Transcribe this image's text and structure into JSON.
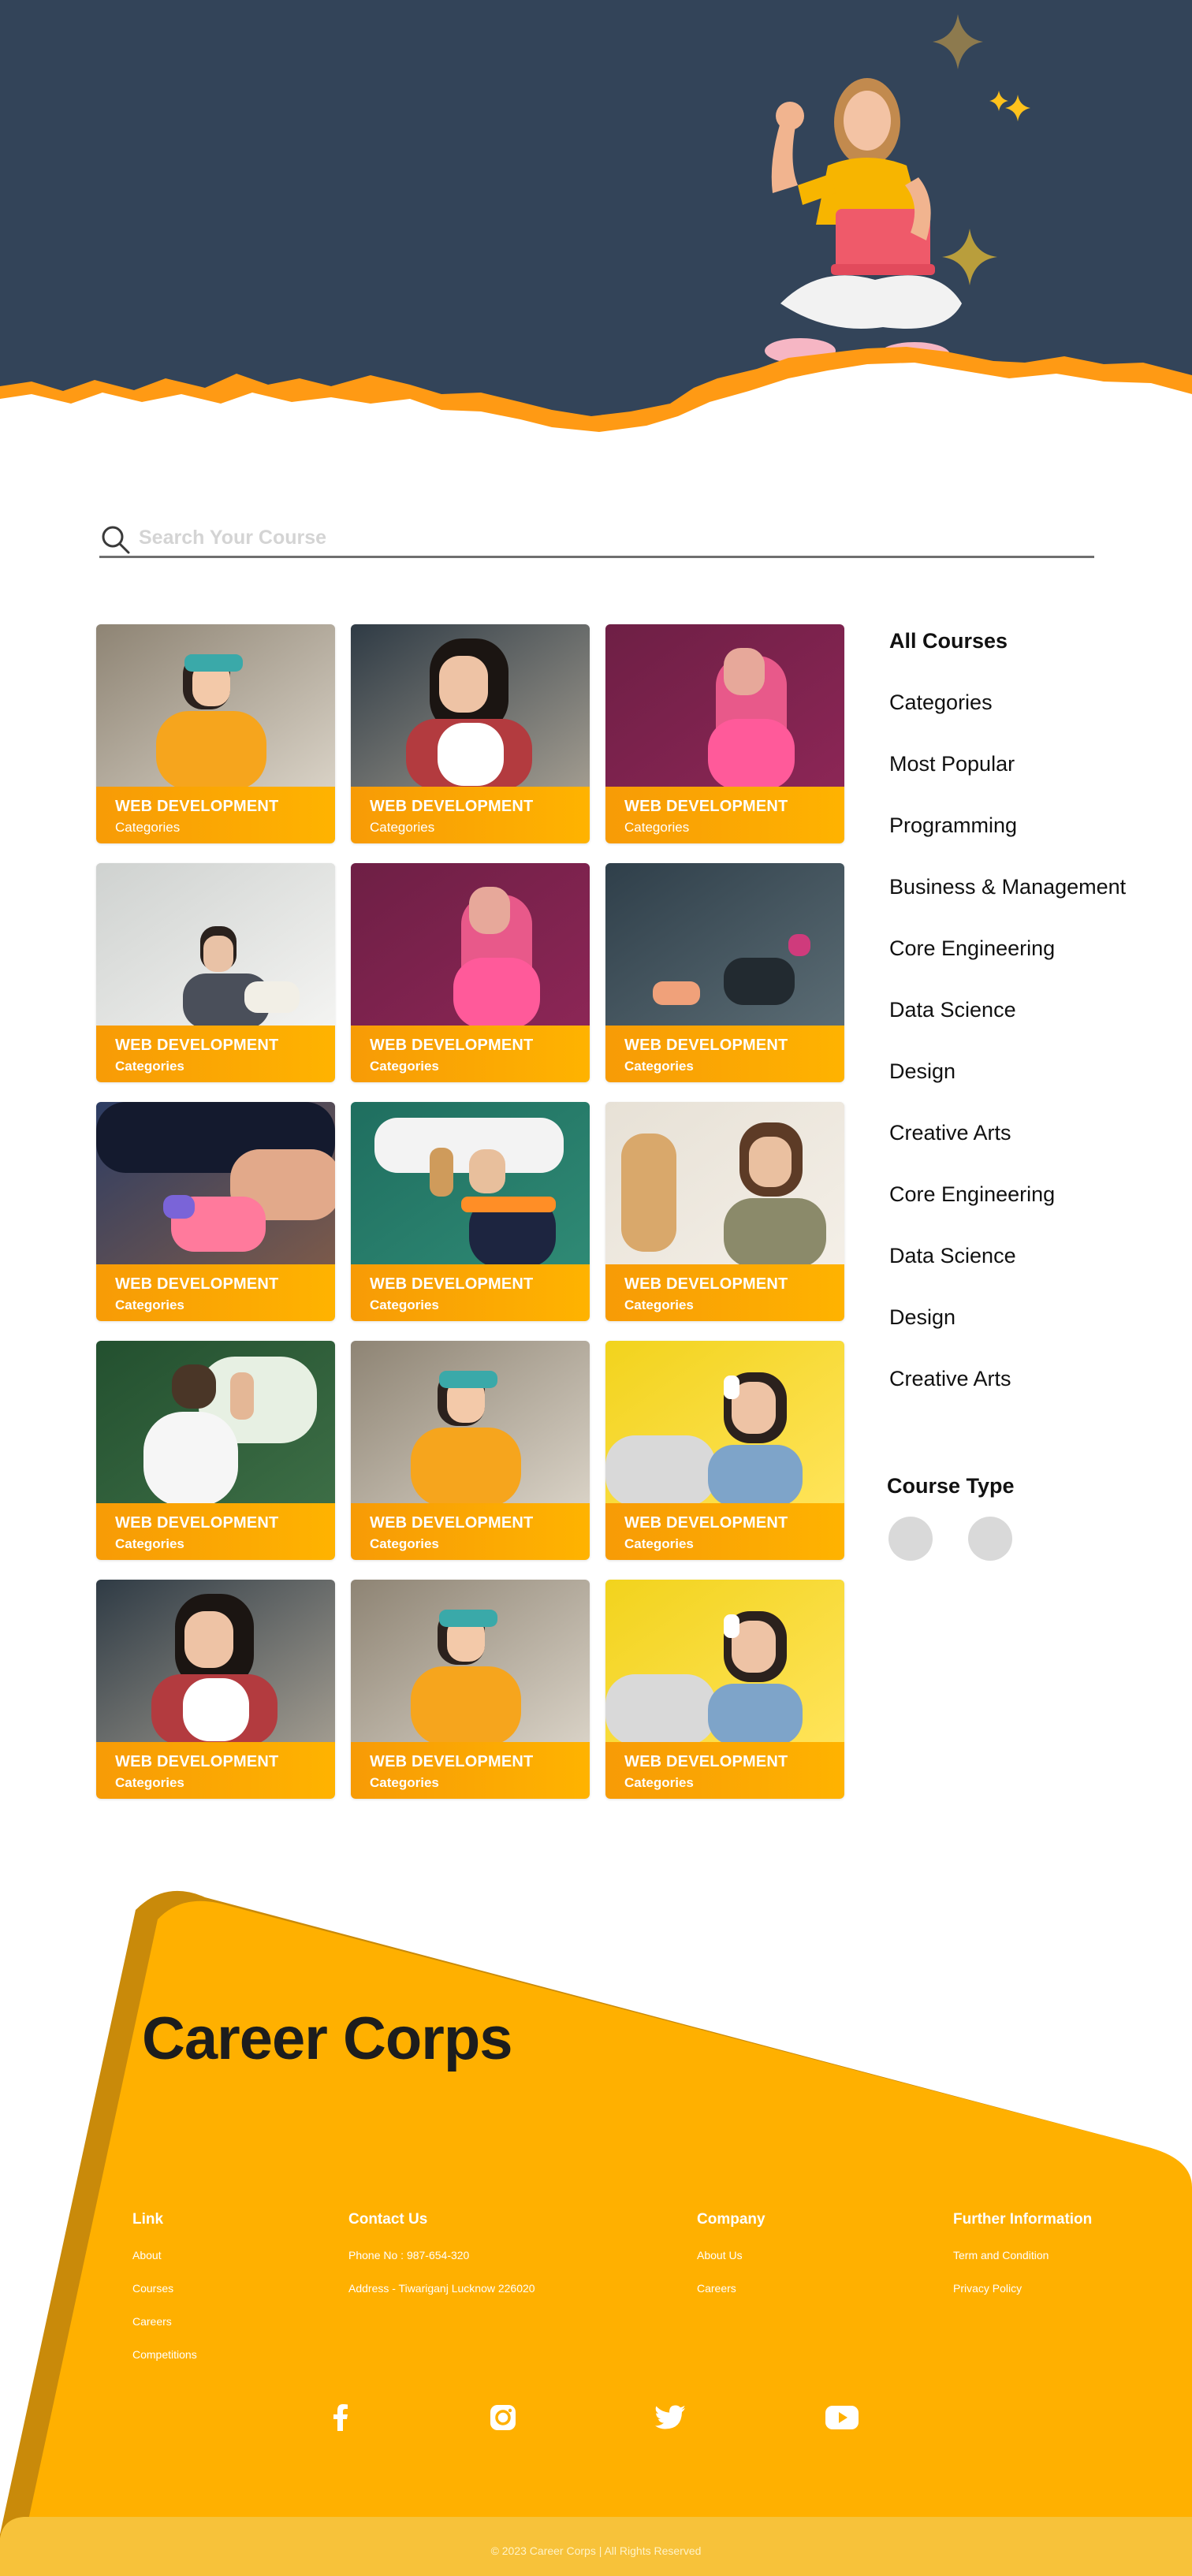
{
  "search": {
    "placeholder": "Search Your Course"
  },
  "cards": [
    {
      "title": "WEB DEVELOPMENT",
      "subtitle": "Categories",
      "photo": "woman-headphones-yellow-shirt"
    },
    {
      "title": "WEB DEVELOPMENT",
      "subtitle": "Categories",
      "photo": "woman-glasses-plaid-shirt"
    },
    {
      "title": "WEB DEVELOPMENT",
      "subtitle": "Categories",
      "photo": "woman-pink-hair-magenta"
    },
    {
      "title": "WEB DEVELOPMENT",
      "subtitle": "Categories",
      "photo": "man-headphones-reading-book"
    },
    {
      "title": "WEB DEVELOPMENT",
      "subtitle": "Categories",
      "photo": "woman-pink-hair-magenta"
    },
    {
      "title": "WEB DEVELOPMENT",
      "subtitle": "Categories",
      "photo": "dancers-dark-wall"
    },
    {
      "title": "WEB DEVELOPMENT",
      "subtitle": "Categories",
      "photo": "drawing-tablet-stylus"
    },
    {
      "title": "WEB DEVELOPMENT",
      "subtitle": "Categories",
      "photo": "man-hourglass-chalkboard"
    },
    {
      "title": "WEB DEVELOPMENT",
      "subtitle": "Categories",
      "photo": "man-curly-hair-painter"
    },
    {
      "title": "WEB DEVELOPMENT",
      "subtitle": "Categories",
      "photo": "boy-writing-chalkboard"
    },
    {
      "title": "WEB DEVELOPMENT",
      "subtitle": "Categories",
      "photo": "woman-headphones-yellow-shirt"
    },
    {
      "title": "WEB DEVELOPMENT",
      "subtitle": "Categories",
      "photo": "woman-headphones-laptop-yellow"
    },
    {
      "title": "WEB DEVELOPMENT",
      "subtitle": "Categories",
      "photo": "woman-glasses-plaid-shirt"
    },
    {
      "title": "WEB DEVELOPMENT",
      "subtitle": "Categories",
      "photo": "woman-headphones-yellow-shirt"
    },
    {
      "title": "WEB DEVELOPMENT",
      "subtitle": "Categories",
      "photo": "woman-headphones-laptop-yellow"
    }
  ],
  "sidebar": {
    "items": [
      {
        "label": "All  Courses",
        "active": true
      },
      {
        "label": "Categories"
      },
      {
        "label": "Most Popular"
      },
      {
        "label": "Programming"
      },
      {
        "label": "Business & Management"
      },
      {
        "label": "Core Engineering"
      },
      {
        "label": "Data Science"
      },
      {
        "label": "Design"
      },
      {
        "label": "Creative Arts"
      },
      {
        "label": "Core Engineering"
      },
      {
        "label": "Data Science"
      },
      {
        "label": "Design"
      },
      {
        "label": "Creative Arts"
      }
    ],
    "course_type_label": "Course Type"
  },
  "footer": {
    "brand": "Career Corps",
    "columns": [
      {
        "heading": "Link",
        "links": [
          "About",
          "Courses",
          "Careers",
          "Competitions"
        ]
      },
      {
        "heading": "Contact Us",
        "links": [
          "Phone No : 987-654-320",
          "Address - Tiwariganj Lucknow 226020"
        ]
      },
      {
        "heading": "Company",
        "links": [
          "About Us",
          "Careers"
        ]
      },
      {
        "heading": "Further Information",
        "links": [
          "Term and Condition",
          "Privacy Policy"
        ]
      }
    ],
    "social": [
      "facebook-icon",
      "instagram-icon",
      "twitter-icon",
      "youtube-icon"
    ],
    "copyright": "© 2023 Career Corps | All Rights Reserved"
  },
  "colors": {
    "hero_bg": "#334459",
    "accent_orange": "#ffb000",
    "band_orange": "#f79b06",
    "footer_shadow": "#c98a0a",
    "copyright_bar": "#f7c23a"
  }
}
